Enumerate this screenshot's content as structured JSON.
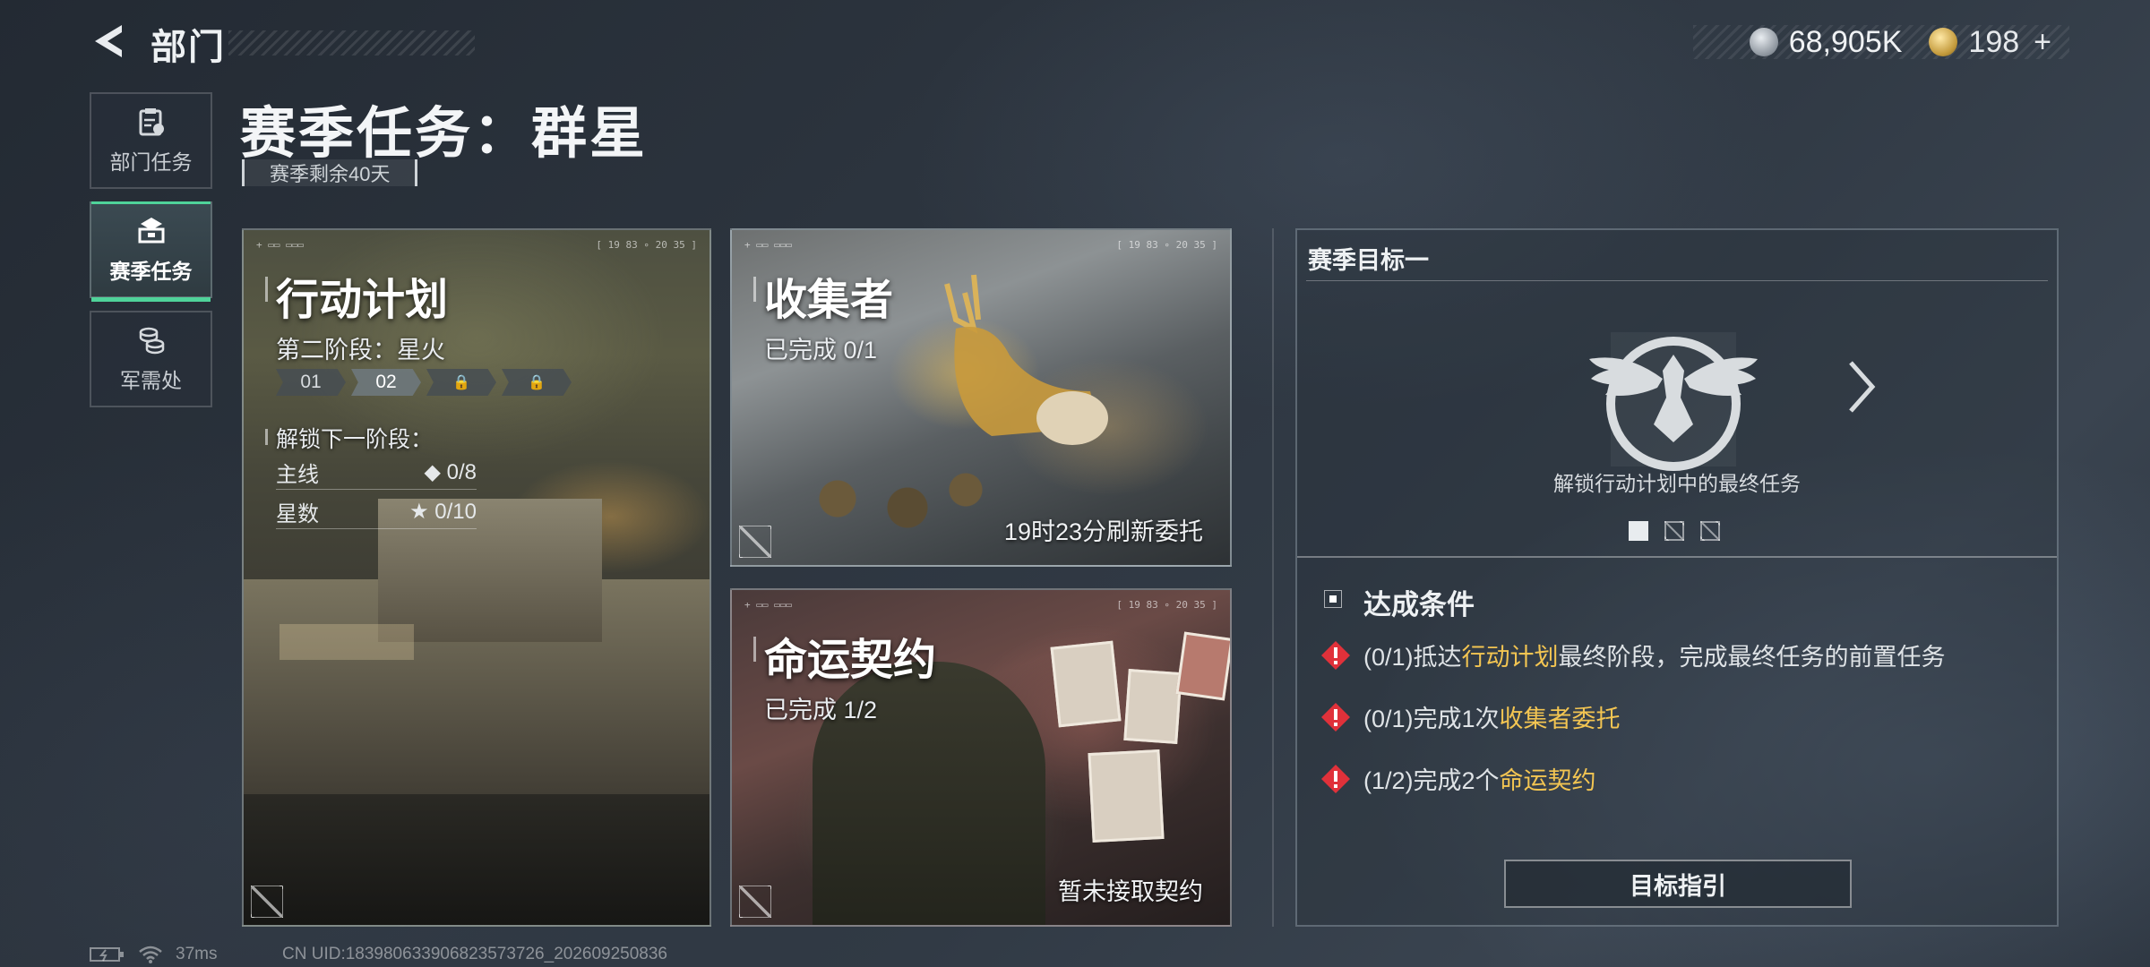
{
  "header": {
    "section_title": "部门",
    "currencies": [
      {
        "icon": "silver-coin-icon",
        "value": "68,905K"
      },
      {
        "icon": "gold-coin-icon",
        "value": "198",
        "suffix": "+"
      }
    ]
  },
  "sidebar": {
    "items": [
      {
        "label": "部门任务",
        "icon": "clipboard-icon",
        "active": false
      },
      {
        "label": "赛季任务",
        "icon": "briefcase-icon",
        "active": true
      },
      {
        "label": "军需处",
        "icon": "coins-stack-icon",
        "active": false
      }
    ]
  },
  "main": {
    "title": "赛季任务：群星",
    "season_remaining": "赛季剩余40天"
  },
  "cards": {
    "plan": {
      "title": "行动计划",
      "stage": "第二阶段：星火",
      "stages": [
        "01",
        "02",
        "🔒",
        "🔒"
      ],
      "unlock_label": "解锁下一阶段：",
      "requirements": [
        {
          "label": "主线",
          "icon": "diamond-icon",
          "value": "0/8"
        },
        {
          "label": "星数",
          "icon": "star-icon",
          "value": "0/10"
        }
      ]
    },
    "collector": {
      "title": "收集者",
      "progress": "已完成 0/1",
      "footer": "19时23分刷新委托"
    },
    "fate": {
      "title": "命运契约",
      "progress": "已完成 1/2",
      "footer": "暂未接取契约"
    }
  },
  "goal": {
    "header": "赛季目标一",
    "description": "解锁行动计划中的最终任务",
    "conditions_title": "达成条件",
    "conditions": [
      {
        "pre": "(0/1)抵达",
        "hl": "行动计划",
        "post": "最终阶段，完成最终任务的前置任务"
      },
      {
        "pre": "(0/1)完成1次",
        "hl": "收集者委托",
        "post": ""
      },
      {
        "pre": "(1/2)完成2个",
        "hl": "命运契约",
        "post": ""
      }
    ],
    "button": "目标指引",
    "page_index": 1,
    "page_count": 3
  },
  "status": {
    "ping": "37ms",
    "uid": "CN UID:18398063390682357372​6_202609250836"
  },
  "colors": {
    "accent": "#4fd39a",
    "highlight": "#f3c552",
    "warning": "#e0313a"
  }
}
